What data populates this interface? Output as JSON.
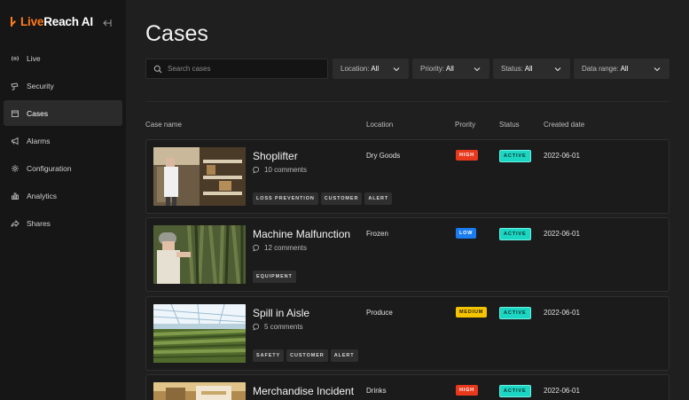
{
  "app": {
    "brand_prefix": "Live",
    "brand_rest": "Reach AI"
  },
  "sidebar": {
    "items": [
      {
        "label": "Live",
        "icon": "broadcast-icon",
        "active": false
      },
      {
        "label": "Security",
        "icon": "camera-icon",
        "active": false
      },
      {
        "label": "Cases",
        "icon": "folder-icon",
        "active": true
      },
      {
        "label": "Alarms",
        "icon": "megaphone-icon",
        "active": false
      },
      {
        "label": "Configuration",
        "icon": "gear-icon",
        "active": false
      },
      {
        "label": "Analytics",
        "icon": "bar-chart-icon",
        "active": false
      },
      {
        "label": "Shares",
        "icon": "share-icon",
        "active": false
      }
    ]
  },
  "main": {
    "title": "Cases",
    "search_placeholder": "Search cases",
    "filters": [
      {
        "label": "Location:",
        "value": "All"
      },
      {
        "label": "Priority:",
        "value": "All"
      },
      {
        "label": "Status:",
        "value": "All"
      },
      {
        "label": "Data range:",
        "value": "All"
      }
    ],
    "columns": [
      "Case name",
      "Location",
      "Prority",
      "Status",
      "Created date"
    ],
    "rows": [
      {
        "name": "Shoplifter",
        "comments": "10 comments",
        "tags": [
          "LOSS PREVENTION",
          "CUSTOMER",
          "ALERT"
        ],
        "location": "Dry Goods",
        "priority": "HIGH",
        "priority_color": "#e8391d",
        "status": "ACTIVE",
        "date": "2022-06-01"
      },
      {
        "name": "Machine Malfunction",
        "comments": "12 comments",
        "tags": [
          "EQUIPMENT"
        ],
        "location": "Frozen",
        "priority": "LOW",
        "priority_color": "#1a7cf0",
        "status": "ACTIVE",
        "date": "2022-06-01"
      },
      {
        "name": "Spill in Aisle",
        "comments": "5 comments",
        "tags": [
          "SAFETY",
          "CUSTOMER",
          "ALERT"
        ],
        "location": "Produce",
        "priority": "MEDIUM",
        "priority_color": "#f5c400",
        "status": "ACTIVE",
        "date": "2022-06-01"
      },
      {
        "name": "Merchandise Incident",
        "comments": "",
        "tags": [],
        "location": "Drinks",
        "priority": "HIGH",
        "priority_color": "#e8391d",
        "status": "ACTIVE",
        "date": "2022-06-01"
      }
    ]
  },
  "colors": {
    "accent": "#ff7a1a",
    "status_active": "#1ad6c3"
  }
}
